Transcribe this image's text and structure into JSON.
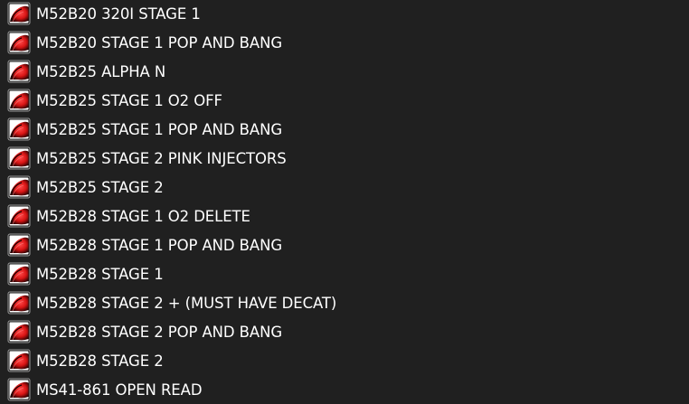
{
  "files": [
    {
      "name": "M52B20 320I STAGE 1",
      "icon": "tuning-file-icon"
    },
    {
      "name": "M52B20 STAGE 1 POP AND BANG",
      "icon": "tuning-file-icon"
    },
    {
      "name": "M52B25 ALPHA N",
      "icon": "tuning-file-icon"
    },
    {
      "name": "M52B25 STAGE 1 O2 OFF",
      "icon": "tuning-file-icon"
    },
    {
      "name": "M52B25 STAGE 1 POP AND BANG",
      "icon": "tuning-file-icon"
    },
    {
      "name": "M52B25 STAGE 2 PINK INJECTORS",
      "icon": "tuning-file-icon"
    },
    {
      "name": "M52B25 STAGE 2",
      "icon": "tuning-file-icon"
    },
    {
      "name": "M52B28 STAGE 1 O2 DELETE",
      "icon": "tuning-file-icon"
    },
    {
      "name": "M52B28 STAGE 1 POP AND BANG",
      "icon": "tuning-file-icon"
    },
    {
      "name": "M52B28 STAGE 1",
      "icon": "tuning-file-icon"
    },
    {
      "name": "M52B28 STAGE 2 + (MUST HAVE DECAT)",
      "icon": "tuning-file-icon"
    },
    {
      "name": "M52B28 STAGE 2 POP AND BANG",
      "icon": "tuning-file-icon"
    },
    {
      "name": "M52B28 STAGE 2",
      "icon": "tuning-file-icon"
    },
    {
      "name": "MS41-861 OPEN READ",
      "icon": "tuning-file-icon"
    }
  ],
  "colors": {
    "background": "#202020",
    "text": "#ffffff",
    "icon_red": "#d81414",
    "icon_dark": "#2a0000"
  }
}
